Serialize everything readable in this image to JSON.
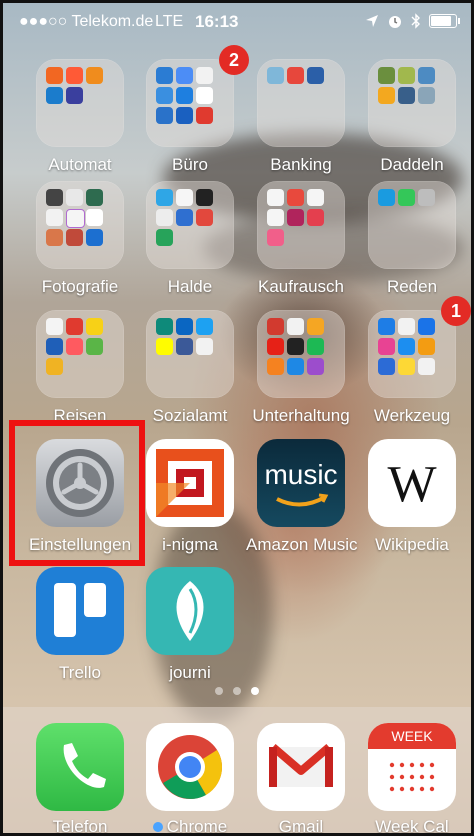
{
  "status_bar": {
    "carrier": "●●●○○ Telekom.de",
    "network": "LTE",
    "time": "16:13"
  },
  "apps": {
    "automat": {
      "label": "Automat",
      "icon": "folder-icon"
    },
    "buero": {
      "label": "Büro",
      "badge": "2",
      "icon": "folder-icon"
    },
    "banking": {
      "label": "Banking",
      "icon": "folder-icon"
    },
    "daddeln": {
      "label": "Daddeln",
      "icon": "folder-icon"
    },
    "fotografie": {
      "label": "Fotografie",
      "icon": "folder-icon"
    },
    "halde": {
      "label": "Halde",
      "icon": "folder-icon"
    },
    "kaufrausch": {
      "label": "Kaufrausch",
      "icon": "folder-icon"
    },
    "reden": {
      "label": "Reden",
      "icon": "folder-icon"
    },
    "reisen": {
      "label": "Reisen",
      "icon": "folder-icon"
    },
    "sozialamt": {
      "label": "Sozialamt",
      "icon": "folder-icon"
    },
    "unterhaltung": {
      "label": "Unterhaltung",
      "icon": "folder-icon"
    },
    "werkzeug": {
      "label": "Werkzeug",
      "badge": "1",
      "icon": "folder-icon"
    },
    "einstellungen": {
      "label": "Einstellungen",
      "icon": "gear-icon"
    },
    "inigma": {
      "label": "i-nigma",
      "icon": "qr-icon"
    },
    "amazon_music": {
      "label": "Amazon Music",
      "icon_text": "music",
      "icon": "amazon-music-icon"
    },
    "wikipedia": {
      "label": "Wikipedia",
      "icon_text": "W",
      "icon": "wikipedia-icon"
    },
    "trello": {
      "label": "Trello",
      "icon": "trello-icon"
    },
    "journi": {
      "label": "journi",
      "icon": "feather-icon"
    }
  },
  "dock": {
    "telefon": {
      "label": "Telefon",
      "icon": "phone-icon"
    },
    "chrome": {
      "label": "Chrome",
      "icon": "chrome-icon"
    },
    "gmail": {
      "label": "Gmail",
      "icon": "gmail-icon"
    },
    "week_cal": {
      "label": "Week Cal",
      "header": "WEEK",
      "icon": "calendar-icon"
    }
  },
  "colors": {
    "highlight": "#ee1111",
    "badge": "#e32b25",
    "phone_green": "#3cc84a",
    "trello_blue": "#1f7fd6",
    "journi_teal": "#35b7b3"
  }
}
